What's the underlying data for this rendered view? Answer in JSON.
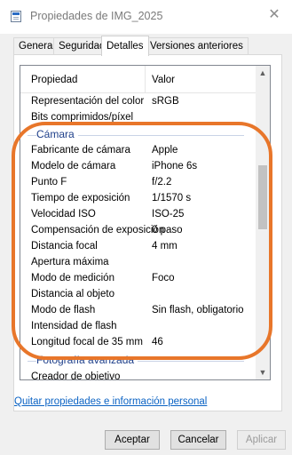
{
  "window": {
    "title": "Propiedades de IMG_2025",
    "close_glyph": "✕"
  },
  "tabs": [
    {
      "label": "General"
    },
    {
      "label": "Seguridad"
    },
    {
      "label": "Detalles",
      "active": true
    },
    {
      "label": "Versiones anteriores"
    }
  ],
  "list": {
    "header": {
      "property": "Propiedad",
      "value": "Valor"
    },
    "rows_top": [
      {
        "property": "Representación del color",
        "value": "sRGB"
      },
      {
        "property": "Bits comprimidos/píxel",
        "value": ""
      }
    ],
    "group_camera": "Cámara",
    "camera_rows": [
      {
        "property": "Fabricante de cámara",
        "value": "Apple"
      },
      {
        "property": "Modelo de cámara",
        "value": "iPhone 6s"
      },
      {
        "property": "Punto F",
        "value": "f/2.2"
      },
      {
        "property": "Tiempo de exposición",
        "value": "1/1570 s"
      },
      {
        "property": "Velocidad ISO",
        "value": "ISO-25"
      },
      {
        "property": "Compensación de exposición",
        "value": "0 paso"
      },
      {
        "property": "Distancia focal",
        "value": "4 mm"
      },
      {
        "property": "Apertura máxima",
        "value": ""
      },
      {
        "property": "Modo de medición",
        "value": "Foco"
      },
      {
        "property": "Distancia al objeto",
        "value": ""
      },
      {
        "property": "Modo de flash",
        "value": "Sin flash, obligatorio"
      },
      {
        "property": "Intensidad de flash",
        "value": ""
      },
      {
        "property": "Longitud focal de 35 mm",
        "value": "46"
      }
    ],
    "group_advanced": "Fotografía avanzada",
    "partial_row": "Creador de objetivo"
  },
  "link": "Quitar propiedades e información personal",
  "buttons": {
    "accept": "Aceptar",
    "cancel": "Cancelar",
    "apply": "Aplicar"
  },
  "colors": {
    "highlight": "#e8762a",
    "group_text": "#1e3f8a",
    "link": "#0b63c4"
  }
}
